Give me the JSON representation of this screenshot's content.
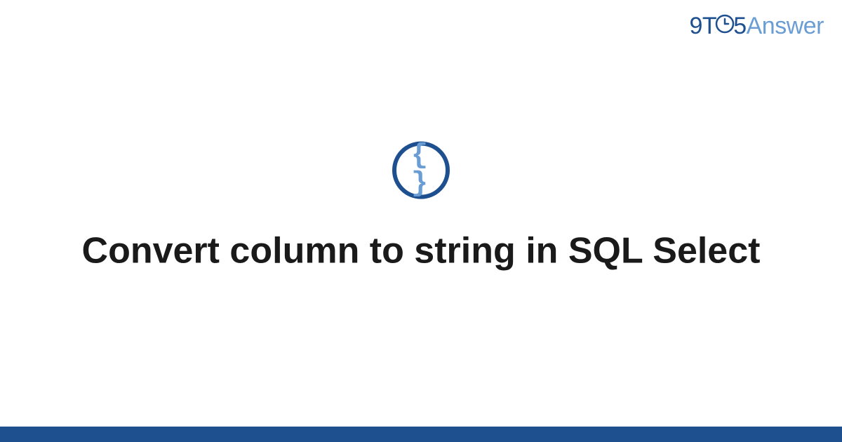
{
  "logo": {
    "nine": "9",
    "t": "T",
    "five": "5",
    "answer": "Answer"
  },
  "icon": {
    "braces": "{ }"
  },
  "title": "Convert column to string in SQL Select"
}
